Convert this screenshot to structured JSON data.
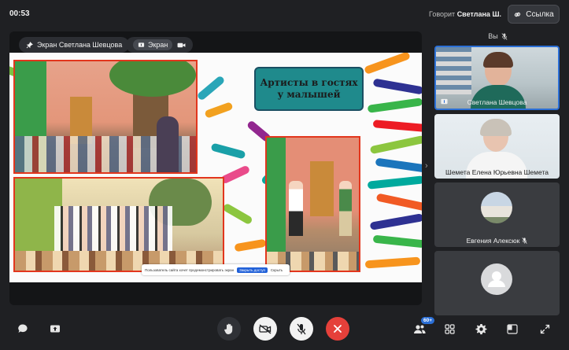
{
  "topbar": {
    "timer": "00:53",
    "speaker_prefix": "Говорит",
    "speaker_name": "Светлана Ш.",
    "link_label": "Ссылка"
  },
  "stage": {
    "screen_owner": "Экран Светлана Шевцова",
    "screen_label": "Экран"
  },
  "slide": {
    "title": "Артисты в гостях у малышей",
    "share_notice": "Пользователь сайта хочет продемонстрировать экран",
    "share_stop": "Закрыть доступ",
    "share_hide": "Скрыть"
  },
  "participants": {
    "you_label": "Вы",
    "items": [
      {
        "name": "Светлана Шевцова"
      },
      {
        "name": "Шемета Елена Юрьевна Шемета"
      },
      {
        "name": "Евгения Алексюк"
      },
      {
        "name": ""
      }
    ]
  },
  "controls": {
    "participants_count": "60+"
  },
  "colors": {
    "accent_blue": "#2b6fd6",
    "end_call_red": "#e5403a",
    "slide_title_bg": "#1f8a8c",
    "photo_border": "#e2361d"
  }
}
